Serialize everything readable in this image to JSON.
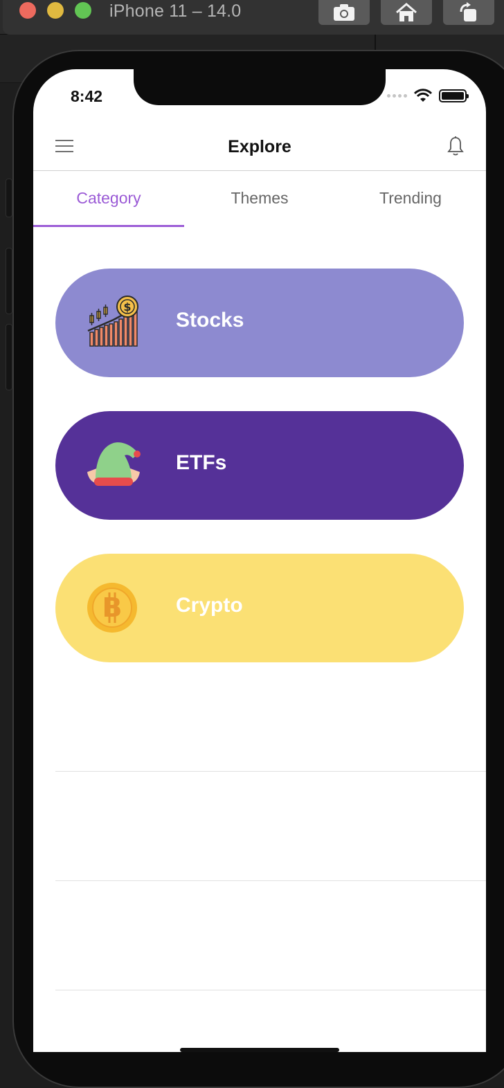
{
  "simulator": {
    "title": "iPhone 11 – 14.0"
  },
  "status_bar": {
    "time": "8:42"
  },
  "header": {
    "title": "Explore"
  },
  "tabs": [
    {
      "label": "Category",
      "active": true
    },
    {
      "label": "Themes",
      "active": false
    },
    {
      "label": "Trending",
      "active": false
    }
  ],
  "categories": [
    {
      "label": "Stocks",
      "icon": "stocks-chart-icon",
      "color": "#8d8ad0"
    },
    {
      "label": "ETFs",
      "icon": "elf-hat-icon",
      "color": "#553198"
    },
    {
      "label": "Crypto",
      "icon": "bitcoin-icon",
      "color": "#fbe074"
    }
  ],
  "colors": {
    "accent": "#9b5bd6"
  }
}
